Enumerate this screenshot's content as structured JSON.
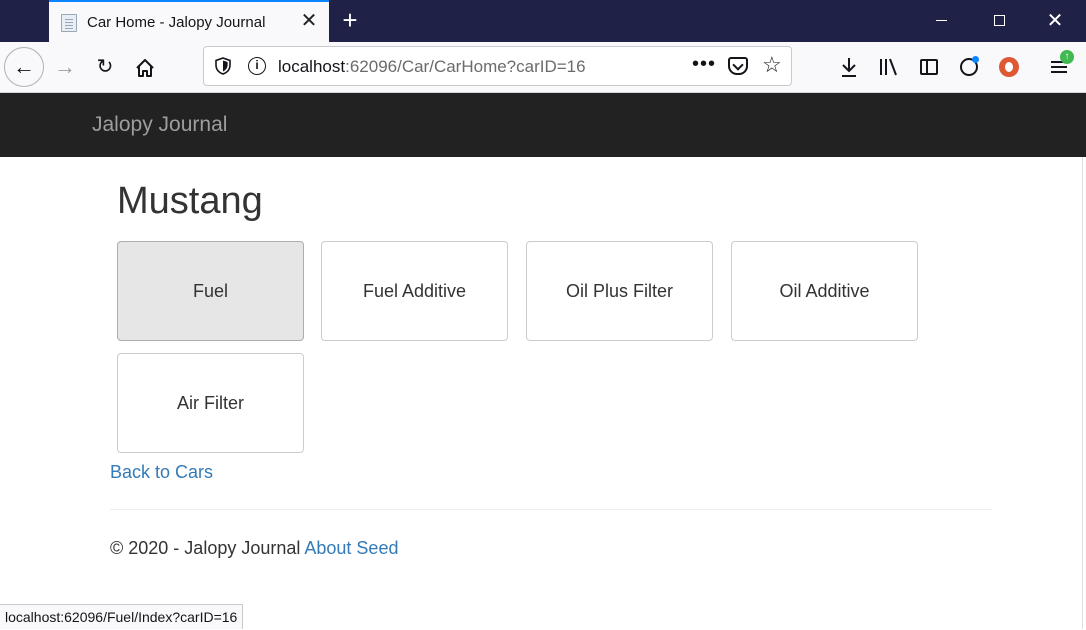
{
  "browser": {
    "tab_title": "Car Home - Jalopy Journal",
    "tab_close": "✕",
    "new_tab": "+",
    "url_host": "localhost",
    "url_rest": ":62096/Car/CarHome?carID=16",
    "url_more": "•••",
    "status_url": "localhost:62096/Fuel/Index?carID=16",
    "accent_color": "#0a84ff",
    "titlebar_color": "#1f2246"
  },
  "site": {
    "brand": "Jalopy Journal",
    "nav_color": "#222222"
  },
  "main": {
    "title": "Mustang",
    "tiles": [
      {
        "label": "Fuel",
        "active": true
      },
      {
        "label": "Fuel Additive",
        "active": false
      },
      {
        "label": "Oil Plus Filter",
        "active": false
      },
      {
        "label": "Oil Additive",
        "active": false
      },
      {
        "label": "Air Filter",
        "active": false
      }
    ],
    "back_link": "Back to Cars"
  },
  "footer": {
    "copyright": "© 2020 - Jalopy Journal",
    "link": "About Seed",
    "link_color": "#337ab7"
  }
}
